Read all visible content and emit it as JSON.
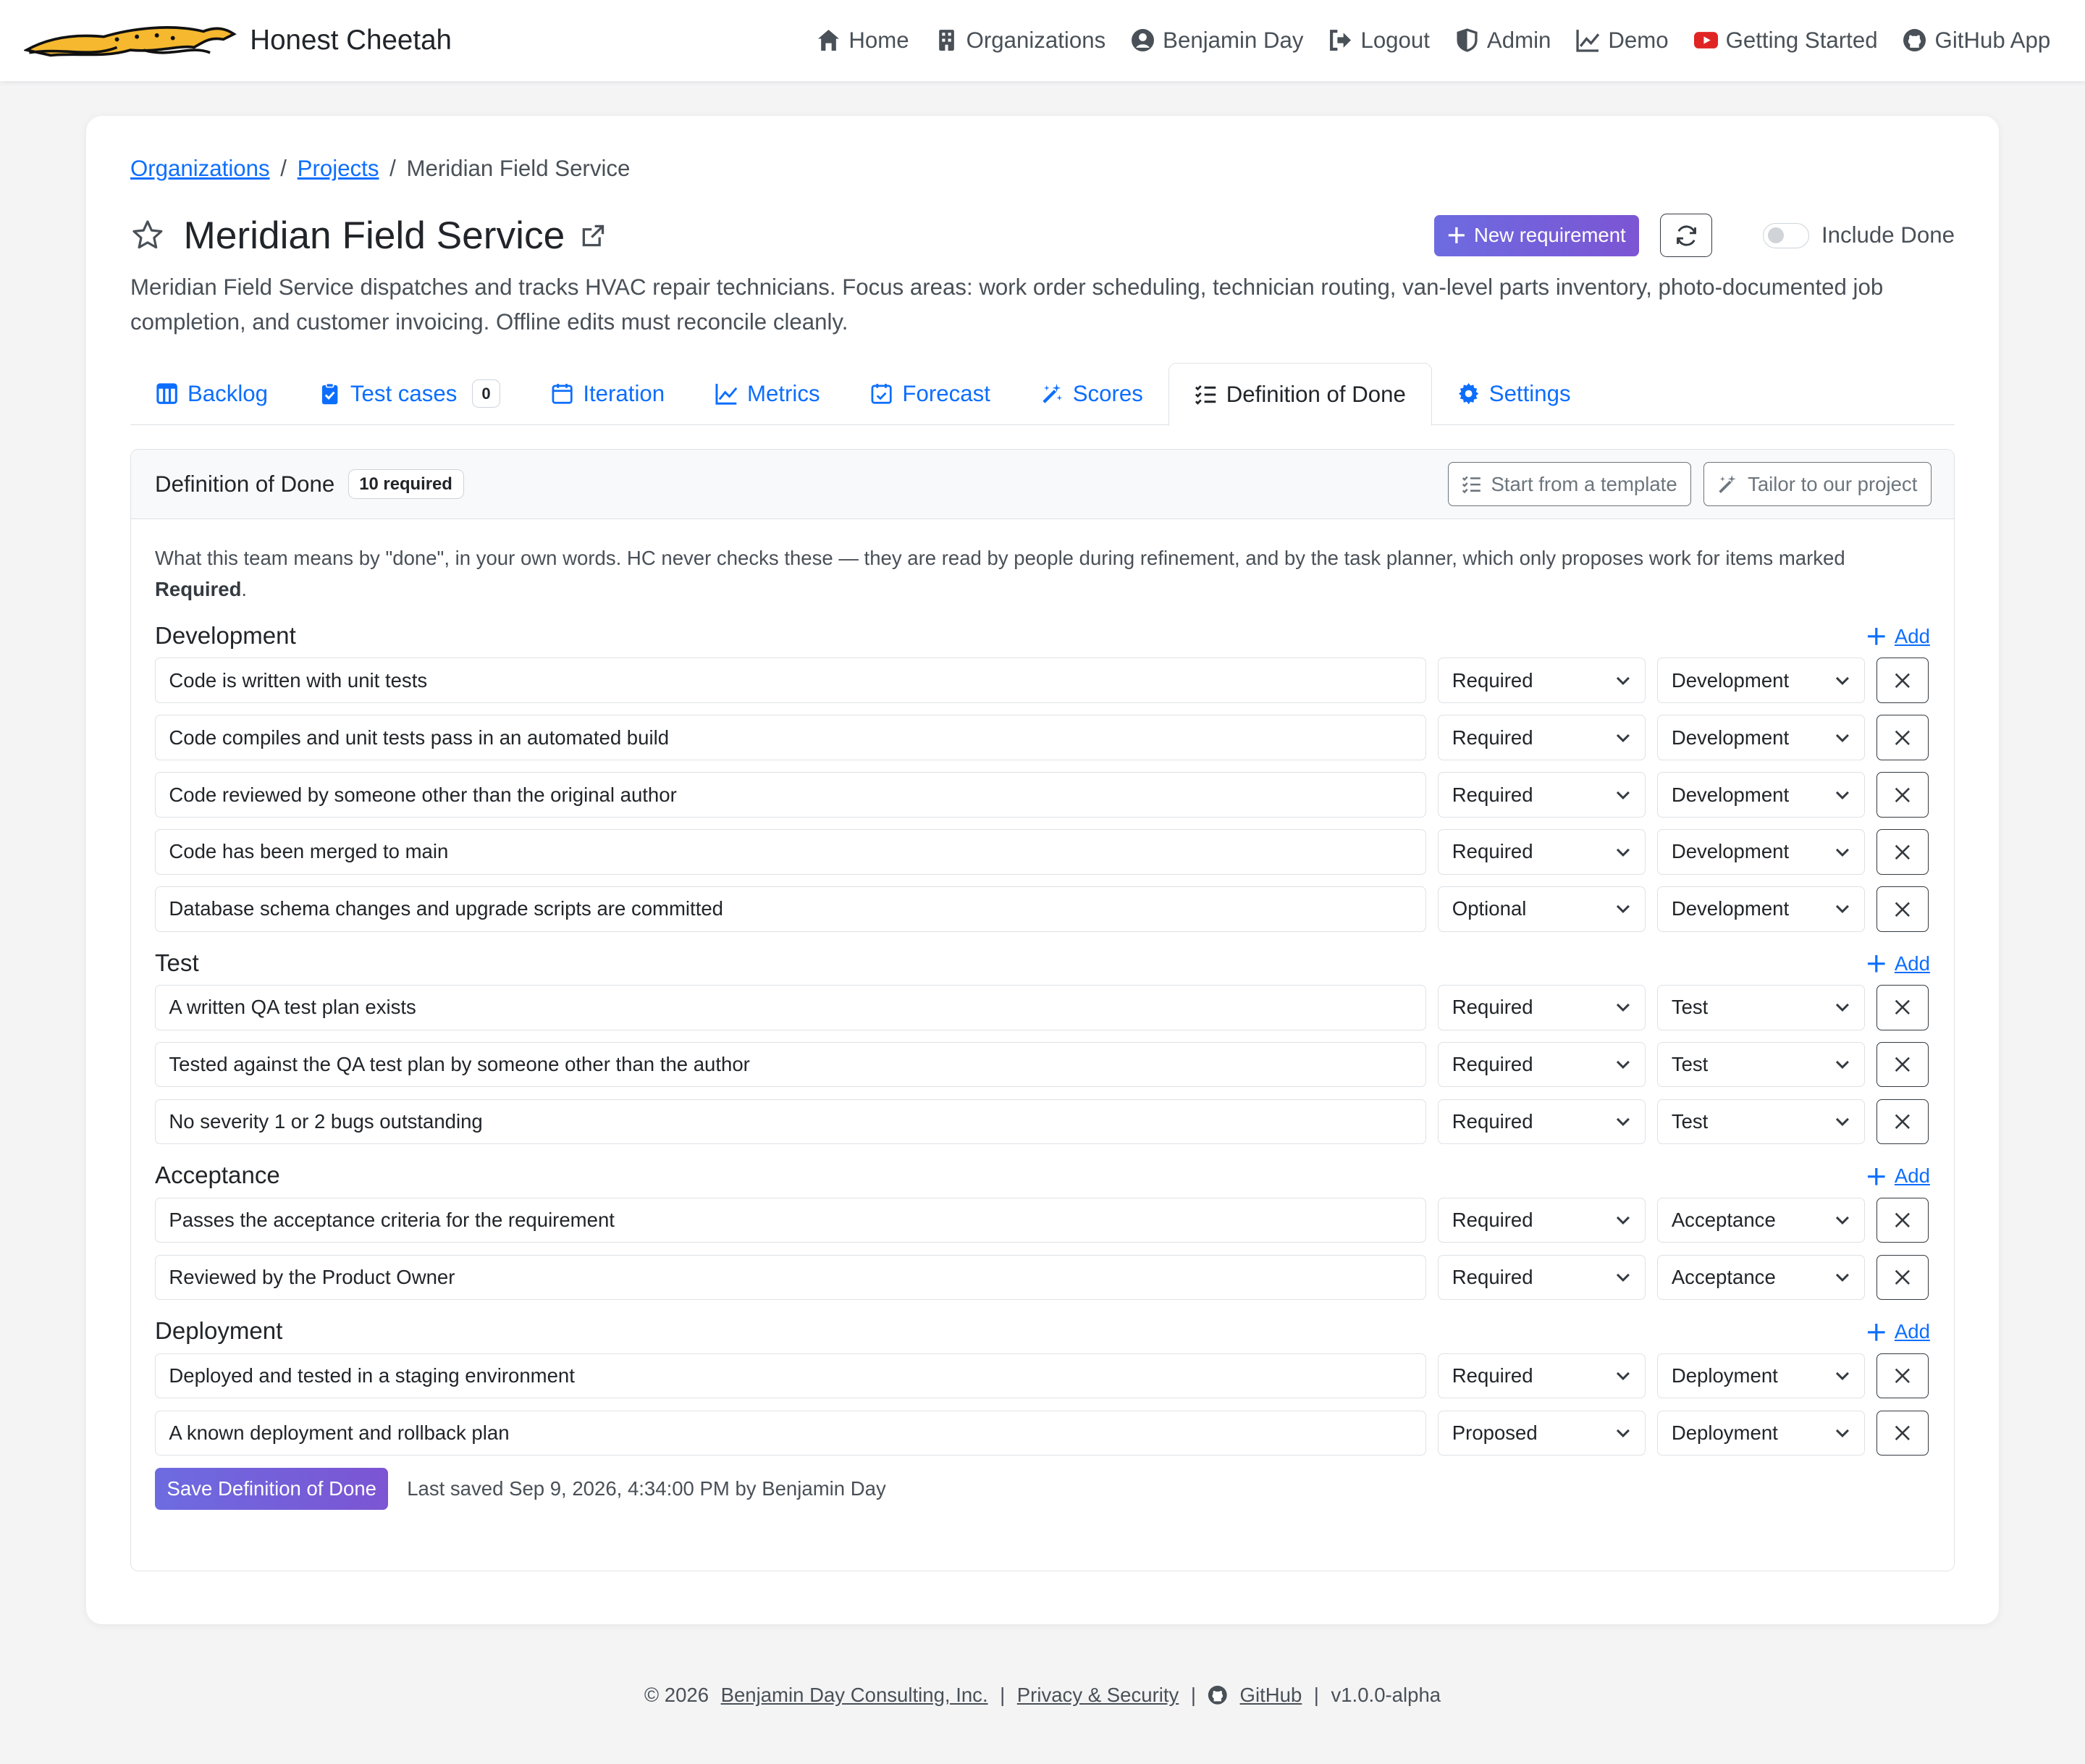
{
  "brand": {
    "name": "Honest Cheetah"
  },
  "nav": [
    {
      "label": "Home",
      "icon": "home-icon"
    },
    {
      "label": "Organizations",
      "icon": "building-icon"
    },
    {
      "label": "Benjamin Day",
      "icon": "user-circle-icon"
    },
    {
      "label": "Logout",
      "icon": "logout-icon"
    },
    {
      "label": "Admin",
      "icon": "shield-icon"
    },
    {
      "label": "Demo",
      "icon": "chart-line-icon"
    },
    {
      "label": "Getting Started",
      "icon": "youtube-icon"
    },
    {
      "label": "GitHub App",
      "icon": "github-icon"
    }
  ],
  "breadcrumb": {
    "organizations": "Organizations",
    "projects": "Projects",
    "current": "Meridian Field Service"
  },
  "project": {
    "title": "Meridian Field Service",
    "description": "Meridian Field Service dispatches and tracks HVAC repair technicians. Focus areas: work order scheduling, technician routing, van-level parts inventory, photo-documented job completion, and customer invoicing. Offline edits must reconcile cleanly.",
    "new_requirement": "New requirement",
    "include_done": "Include Done"
  },
  "tabs": [
    {
      "label": "Backlog"
    },
    {
      "label": "Test cases",
      "count": "0"
    },
    {
      "label": "Iteration"
    },
    {
      "label": "Metrics"
    },
    {
      "label": "Forecast"
    },
    {
      "label": "Scores"
    },
    {
      "label": "Definition of Done"
    },
    {
      "label": "Settings"
    }
  ],
  "dod": {
    "title": "Definition of Done",
    "badge": "10 required",
    "template_btn": "Start from a template",
    "tailor_btn": "Tailor to our project",
    "intro_a": "What this team means by \"done\", in your own words. HC never checks these — they are read by people during refinement, and by the task planner, which only proposes work for items marked ",
    "intro_b": "Required",
    "intro_c": ".",
    "add_label": "Add",
    "groups": [
      {
        "title": "Development",
        "items": [
          {
            "text": "Code is written with unit tests",
            "status": "Required",
            "category": "Development"
          },
          {
            "text": "Code compiles and unit tests pass in an automated build",
            "status": "Required",
            "category": "Development"
          },
          {
            "text": "Code reviewed by someone other than the original author",
            "status": "Required",
            "category": "Development"
          },
          {
            "text": "Code has been merged to main",
            "status": "Required",
            "category": "Development"
          },
          {
            "text": "Database schema changes and upgrade scripts are committed",
            "status": "Optional",
            "category": "Development"
          }
        ]
      },
      {
        "title": "Test",
        "items": [
          {
            "text": "A written QA test plan exists",
            "status": "Required",
            "category": "Test"
          },
          {
            "text": "Tested against the QA test plan by someone other than the author",
            "status": "Required",
            "category": "Test"
          },
          {
            "text": "No severity 1 or 2 bugs outstanding",
            "status": "Required",
            "category": "Test"
          }
        ]
      },
      {
        "title": "Acceptance",
        "items": [
          {
            "text": "Passes the acceptance criteria for the requirement",
            "status": "Required",
            "category": "Acceptance"
          },
          {
            "text": "Reviewed by the Product Owner",
            "status": "Required",
            "category": "Acceptance"
          }
        ]
      },
      {
        "title": "Deployment",
        "items": [
          {
            "text": "Deployed and tested in a staging environment",
            "status": "Required",
            "category": "Deployment"
          },
          {
            "text": "A known deployment and rollback plan",
            "status": "Proposed",
            "category": "Deployment"
          }
        ]
      }
    ],
    "save_label": "Save Definition of Done",
    "last_saved": "Last saved Sep 9, 2026, 4:34:00 PM by Benjamin Day"
  },
  "footer": {
    "copyright": "© 2026",
    "company": "Benjamin Day Consulting, Inc.",
    "privacy": "Privacy & Security",
    "github": "GitHub",
    "version": "v1.0.0-alpha",
    "sep": "|"
  }
}
